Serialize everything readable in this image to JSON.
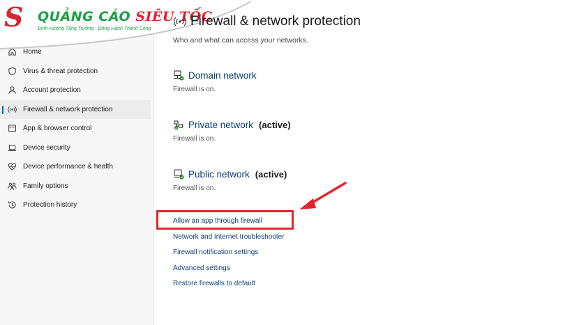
{
  "logo": {
    "letter": "S",
    "title_a": "QUẢNG CÁO ",
    "title_b": "SIÊU TỐC",
    "tagline": "Định Hướng Tăng Trưởng - Đồng Hành Thành Công"
  },
  "sidebar": {
    "items": [
      {
        "label": "Home",
        "icon": "home-icon"
      },
      {
        "label": "Virus & threat protection",
        "icon": "shield-icon"
      },
      {
        "label": "Account protection",
        "icon": "person-icon"
      },
      {
        "label": "Firewall & network protection",
        "icon": "antenna-icon",
        "selected": true
      },
      {
        "label": "App & browser control",
        "icon": "browser-window-icon"
      },
      {
        "label": "Device security",
        "icon": "laptop-icon"
      },
      {
        "label": "Device performance & health",
        "icon": "heart-pulse-icon"
      },
      {
        "label": "Family options",
        "icon": "family-icon"
      },
      {
        "label": "Protection history",
        "icon": "history-icon"
      }
    ]
  },
  "main": {
    "title": "Firewall & network protection",
    "subtitle": "Who and what can access your networks.",
    "networks": [
      {
        "name": "Domain network",
        "active": "",
        "status": "Firewall is on.",
        "icon": "domain-network-icon"
      },
      {
        "name": "Private network",
        "active": "(active)",
        "status": "Firewall is on.",
        "icon": "private-network-icon"
      },
      {
        "name": "Public network",
        "active": "(active)",
        "status": "Firewall is on.",
        "icon": "public-network-icon"
      }
    ],
    "links": [
      "Allow an app through firewall",
      "Network and Internet troubleshooter",
      "Firewall notification settings",
      "Advanced settings",
      "Restore firewalls to default"
    ]
  },
  "annotation_color": "#e0262c",
  "accent_color": "#0067c0"
}
